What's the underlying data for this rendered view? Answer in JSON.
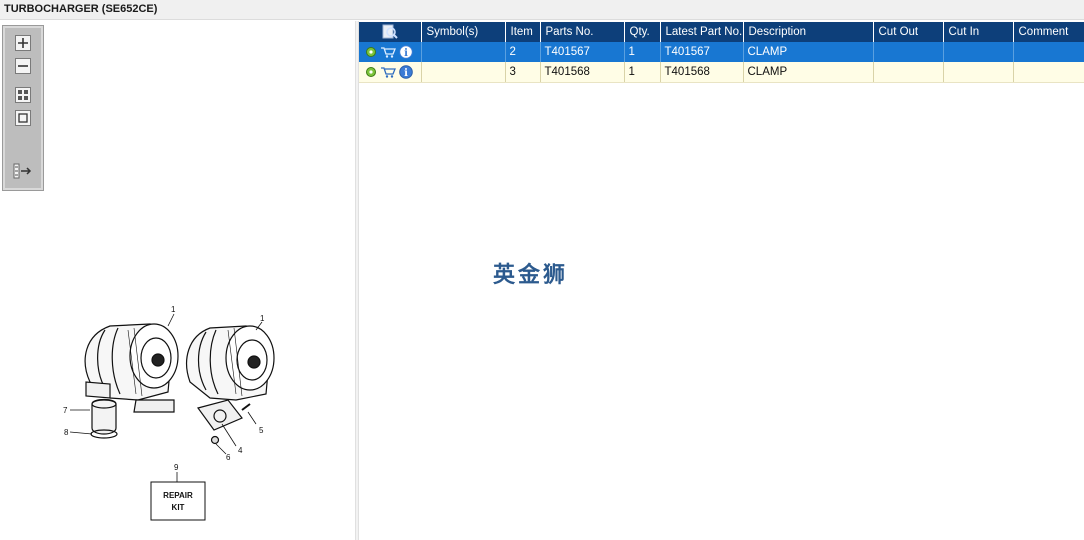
{
  "window": {
    "title": "TURBOCHARGER (SE652CE)"
  },
  "toolbox": {
    "tools": [
      {
        "name": "zoom-in",
        "icon": "zoom-in-icon"
      },
      {
        "name": "zoom-out",
        "icon": "zoom-out-icon"
      },
      {
        "name": "fit-all",
        "icon": "fit-all-icon"
      },
      {
        "name": "actual-size",
        "icon": "actual-size-icon"
      },
      {
        "name": "toggle-list",
        "icon": "list-arrow-icon"
      }
    ]
  },
  "diagram": {
    "callouts": [
      "1",
      "1",
      "7",
      "8",
      "5",
      "4",
      "6",
      "9"
    ],
    "repair_kit_line1": "REPAIR",
    "repair_kit_line2": "KIT"
  },
  "table": {
    "columns": [
      "",
      "Symbol(s)",
      "Item",
      "Parts No.",
      "Qty.",
      "Latest Part No.",
      "Description",
      "Cut Out",
      "Cut In",
      "Comment"
    ],
    "rows": [
      {
        "symbols": "",
        "item": "2",
        "part_no": "T401567",
        "qty": "1",
        "latest_part_no": "T401567",
        "description": "CLAMP",
        "cut_out": "",
        "cut_in": "",
        "comment": ""
      },
      {
        "symbols": "",
        "item": "3",
        "part_no": "T401568",
        "qty": "1",
        "latest_part_no": "T401568",
        "description": "CLAMP",
        "cut_out": "",
        "cut_in": "",
        "comment": ""
      }
    ]
  },
  "watermark": "英金狮",
  "colors": {
    "header": "#0d3f7a",
    "selected_row": "#1877d2",
    "alt_row": "#fffde6",
    "toolbox": "#bdbdbd"
  }
}
